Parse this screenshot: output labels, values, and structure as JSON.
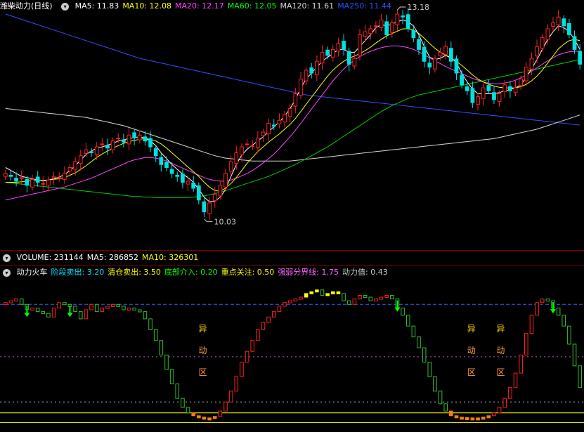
{
  "main_panel": {
    "title": "潍柴动力(日线)",
    "ma_labels": [
      {
        "text": "MA5: 11.83",
        "color": "#ffffff"
      },
      {
        "text": "MA10: 12.08",
        "color": "#ffff00"
      },
      {
        "text": "MA20: 12.17",
        "color": "#ff44ff"
      },
      {
        "text": "MA60: 12.05",
        "color": "#00ff00"
      },
      {
        "text": "MA120: 11.61",
        "color": "#d8d8d8"
      },
      {
        "text": "MA250: 11.44",
        "color": "#3050ff"
      }
    ],
    "high_label": "13.18",
    "low_label": "10.03"
  },
  "volume_panel": {
    "labels": [
      {
        "text": "VOLUME: 231144",
        "color": "#ffffff"
      },
      {
        "text": "MA5: 286852",
        "color": "#ffffff"
      },
      {
        "text": "MA10: 326301",
        "color": "#ffff00"
      }
    ]
  },
  "indicator_panel": {
    "labels": [
      {
        "text": "动力火车",
        "color": "#ffffff"
      },
      {
        "text": "阶段卖出: 3.20",
        "color": "#00e5ff"
      },
      {
        "text": "清仓卖出: 3.50",
        "color": "#ffff00"
      },
      {
        "text": "底部介入: 0.20",
        "color": "#00ff00"
      },
      {
        "text": "重点关注: 0.50",
        "color": "#ffff00"
      },
      {
        "text": "强弱分界线: 1.75",
        "color": "#ff66ff"
      },
      {
        "text": "动力值: 0.43",
        "color": "#cccccc"
      }
    ],
    "zone_label_chars": [
      "异",
      "动",
      "区"
    ]
  },
  "colors": {
    "up": "#ff2020",
    "down": "#00e0e0",
    "ind_up": "#ff2020",
    "ind_down": "#30c030",
    "bottom": "#ff8000",
    "top": "#ffff00",
    "ma5": "#ffffff",
    "ma10": "#ffff00",
    "ma20": "#ff44ff",
    "ma60": "#00cc00",
    "ma120": "#d8d8d8",
    "ma250": "#3050ff"
  },
  "chart_data": {
    "type": "candlestick",
    "price_range": [
      9.6,
      13.55
    ],
    "close": [
      10.85,
      10.8,
      10.72,
      10.78,
      10.65,
      10.75,
      10.7,
      10.68,
      10.74,
      10.8,
      10.78,
      10.85,
      10.95,
      11.05,
      11.15,
      11.25,
      11.2,
      11.3,
      11.35,
      11.28,
      11.4,
      11.45,
      11.38,
      11.5,
      11.45,
      11.5,
      11.4,
      11.3,
      11.15,
      11.0,
      10.95,
      10.85,
      10.8,
      10.7,
      10.72,
      10.6,
      10.4,
      10.2,
      10.35,
      10.5,
      10.65,
      10.85,
      11.05,
      11.2,
      11.3,
      11.35,
      11.32,
      11.45,
      11.55,
      11.7,
      11.65,
      11.75,
      11.85,
      11.95,
      12.2,
      12.45,
      12.6,
      12.55,
      12.75,
      12.9,
      12.85,
      12.95,
      13.05,
      12.95,
      12.7,
      12.8,
      13.2,
      13.25,
      13.3,
      13.35,
      13.45,
      13.2,
      13.4,
      13.55,
      13.5,
      13.3,
      13.15,
      12.95,
      12.75,
      12.65,
      12.8,
      12.9,
      13.0,
      12.75,
      12.55,
      12.35,
      12.25,
      12.05,
      12.15,
      12.3,
      12.25,
      12.1,
      12.2,
      12.35,
      12.25,
      12.3,
      12.45,
      12.65,
      12.8,
      13.0,
      13.15,
      13.3,
      13.4,
      13.5,
      13.35,
      13.2,
      12.95,
      12.7
    ],
    "ma5": [
      10.95,
      10.9,
      10.85,
      10.8,
      10.78,
      10.76,
      10.74,
      10.72,
      10.74,
      10.76,
      10.79,
      10.83,
      10.9,
      10.98,
      11.08,
      11.17,
      11.23,
      11.28,
      11.3,
      11.33,
      11.36,
      11.4,
      11.42,
      11.44,
      11.46,
      11.47,
      11.45,
      11.4,
      11.32,
      11.2,
      11.1,
      11.0,
      10.92,
      10.84,
      10.78,
      10.7,
      10.58,
      10.45,
      10.37,
      10.38,
      10.45,
      10.58,
      10.8,
      11.0,
      11.16,
      11.26,
      11.33,
      11.4,
      11.47,
      11.56,
      11.64,
      11.72,
      11.82,
      11.95,
      12.1,
      12.3,
      12.45,
      12.55,
      12.65,
      12.75,
      12.82,
      12.88,
      12.95,
      12.95,
      12.9,
      12.9,
      13.0,
      13.1,
      13.2,
      13.32,
      13.37,
      13.35,
      13.38,
      13.42,
      13.45,
      13.42,
      13.35,
      13.2,
      13.0,
      12.82,
      12.78,
      12.8,
      12.85,
      12.82,
      12.72,
      12.55,
      12.4,
      12.28,
      12.2,
      12.2,
      12.2,
      12.2,
      12.22,
      12.25,
      12.27,
      12.3,
      12.35,
      12.48,
      12.62,
      12.78,
      12.95,
      13.12,
      13.25,
      13.35,
      13.32,
      13.25,
      13.12,
      12.95
    ],
    "ma10": [
      10.7,
      10.7,
      10.7,
      10.71,
      10.72,
      10.73,
      10.73,
      10.73,
      10.74,
      10.75,
      10.76,
      10.78,
      10.82,
      10.86,
      10.92,
      10.98,
      11.05,
      11.12,
      11.18,
      11.23,
      11.28,
      11.32,
      11.36,
      11.39,
      11.41,
      11.43,
      11.44,
      11.43,
      11.4,
      11.35,
      11.28,
      11.2,
      11.12,
      11.04,
      10.96,
      10.88,
      10.8,
      10.7,
      10.62,
      10.56,
      10.55,
      10.6,
      10.68,
      10.78,
      10.9,
      11.02,
      11.12,
      11.22,
      11.3,
      11.38,
      11.45,
      11.52,
      11.6,
      11.68,
      11.78,
      11.9,
      12.02,
      12.14,
      12.26,
      12.38,
      12.5,
      12.6,
      12.68,
      12.75,
      12.8,
      12.84,
      12.88,
      12.93,
      12.99,
      13.06,
      13.12,
      13.18,
      13.22,
      13.26,
      13.3,
      13.3,
      13.28,
      13.22,
      13.14,
      13.05,
      12.97,
      12.9,
      12.85,
      12.8,
      12.75,
      12.68,
      12.6,
      12.52,
      12.45,
      12.4,
      12.36,
      12.33,
      12.31,
      12.3,
      12.3,
      12.3,
      12.32,
      12.36,
      12.42,
      12.5,
      12.6,
      12.72,
      12.84,
      12.96,
      13.04,
      13.1,
      13.12,
      13.1
    ],
    "ma20": [
      10.4,
      10.42,
      10.44,
      10.46,
      10.48,
      10.5,
      10.52,
      10.54,
      10.56,
      10.58,
      10.6,
      10.62,
      10.65,
      10.68,
      10.71,
      10.74,
      10.77,
      10.81,
      10.85,
      10.89,
      10.93,
      10.97,
      11.01,
      11.05,
      11.08,
      11.1,
      11.12,
      11.12,
      11.11,
      11.09,
      11.06,
      11.02,
      10.98,
      10.94,
      10.9,
      10.86,
      10.82,
      10.78,
      10.75,
      10.73,
      10.72,
      10.72,
      10.74,
      10.77,
      10.81,
      10.85,
      10.9,
      10.96,
      11.03,
      11.1,
      11.18,
      11.27,
      11.37,
      11.47,
      11.58,
      11.7,
      11.82,
      11.94,
      12.06,
      12.18,
      12.3,
      12.42,
      12.52,
      12.62,
      12.7,
      12.77,
      12.83,
      12.88,
      12.92,
      12.95,
      12.98,
      13.0,
      13.01,
      13.01,
      13.0,
      12.98,
      12.95,
      12.91,
      12.86,
      12.81,
      12.76,
      12.71,
      12.66,
      12.62,
      12.58,
      12.54,
      12.5,
      12.46,
      12.43,
      12.4,
      12.38,
      12.37,
      12.37,
      12.38,
      12.4,
      12.43,
      12.47,
      12.52,
      12.58,
      12.64,
      12.7,
      12.76,
      12.81,
      12.86,
      12.89,
      12.91,
      12.92,
      12.92
    ],
    "ma60": [
      10.7,
      10.69,
      10.68,
      10.67,
      10.66,
      10.65,
      10.64,
      10.63,
      10.62,
      10.61,
      10.6,
      10.59,
      10.58,
      10.57,
      10.56,
      10.55,
      10.54,
      10.53,
      10.52,
      10.51,
      10.5,
      10.49,
      10.48,
      10.47,
      10.46,
      10.46,
      10.45,
      10.45,
      10.44,
      10.44,
      10.44,
      10.44,
      10.44,
      10.44,
      10.44,
      10.45,
      10.46,
      10.47,
      10.49,
      10.51,
      10.53,
      10.56,
      10.59,
      10.62,
      10.65,
      10.68,
      10.71,
      10.74,
      10.77,
      10.8,
      10.84,
      10.88,
      10.92,
      10.96,
      11.0,
      11.05,
      11.1,
      11.15,
      11.2,
      11.25,
      11.3,
      11.36,
      11.42,
      11.48,
      11.54,
      11.6,
      11.66,
      11.72,
      11.78,
      11.84,
      11.9,
      11.95,
      12.0,
      12.04,
      12.08,
      12.12,
      12.15,
      12.18,
      12.2,
      12.22,
      12.24,
      12.26,
      12.28,
      12.3,
      12.32,
      12.34,
      12.36,
      12.38,
      12.4,
      12.42,
      12.44,
      12.46,
      12.48,
      12.5,
      12.52,
      12.54,
      12.56,
      12.58,
      12.6,
      12.62,
      12.64,
      12.66,
      12.68,
      12.7,
      12.72,
      12.74,
      12.76,
      12.78
    ],
    "ma120": [
      11.95,
      11.94,
      11.93,
      11.92,
      11.91,
      11.9,
      11.89,
      11.88,
      11.87,
      11.86,
      11.85,
      11.84,
      11.83,
      11.82,
      11.81,
      11.8,
      11.78,
      11.76,
      11.74,
      11.72,
      11.7,
      11.68,
      11.66,
      11.63,
      11.6,
      11.57,
      11.54,
      11.51,
      11.48,
      11.45,
      11.42,
      11.39,
      11.36,
      11.33,
      11.3,
      11.27,
      11.24,
      11.21,
      11.18,
      11.15,
      11.13,
      11.11,
      11.1,
      11.09,
      11.08,
      11.07,
      11.06,
      11.06,
      11.06,
      11.06,
      11.06,
      11.06,
      11.06,
      11.06,
      11.07,
      11.08,
      11.09,
      11.1,
      11.11,
      11.12,
      11.13,
      11.14,
      11.15,
      11.16,
      11.17,
      11.18,
      11.19,
      11.2,
      11.21,
      11.22,
      11.23,
      11.24,
      11.25,
      11.26,
      11.27,
      11.28,
      11.29,
      11.3,
      11.31,
      11.32,
      11.33,
      11.34,
      11.35,
      11.36,
      11.37,
      11.38,
      11.39,
      11.4,
      11.41,
      11.42,
      11.43,
      11.44,
      11.46,
      11.48,
      11.5,
      11.52,
      11.54,
      11.56,
      11.58,
      11.6,
      11.63,
      11.66,
      11.69,
      11.72,
      11.75,
      11.78,
      11.81,
      11.84
    ],
    "ma250": [
      13.55,
      13.52,
      13.49,
      13.46,
      13.43,
      13.4,
      13.37,
      13.34,
      13.31,
      13.28,
      13.25,
      13.22,
      13.19,
      13.16,
      13.13,
      13.1,
      13.07,
      13.04,
      13.01,
      12.98,
      12.95,
      12.92,
      12.89,
      12.86,
      12.83,
      12.8,
      12.78,
      12.76,
      12.74,
      12.72,
      12.7,
      12.68,
      12.66,
      12.64,
      12.62,
      12.6,
      12.58,
      12.56,
      12.54,
      12.52,
      12.5,
      12.48,
      12.46,
      12.44,
      12.42,
      12.4,
      12.38,
      12.36,
      12.34,
      12.32,
      12.3,
      12.28,
      12.26,
      12.24,
      12.22,
      12.2,
      12.18,
      12.17,
      12.16,
      12.15,
      12.14,
      12.13,
      12.12,
      12.11,
      12.1,
      12.09,
      12.08,
      12.07,
      12.06,
      12.05,
      12.04,
      12.03,
      12.02,
      12.01,
      12.0,
      11.99,
      11.98,
      11.97,
      11.96,
      11.95,
      11.94,
      11.93,
      11.92,
      11.91,
      11.9,
      11.89,
      11.88,
      11.87,
      11.86,
      11.85,
      11.84,
      11.83,
      11.82,
      11.81,
      11.8,
      11.79,
      11.78,
      11.77,
      11.76,
      11.75,
      11.74,
      11.73,
      11.72,
      11.71,
      11.7,
      11.69,
      11.68,
      11.67
    ],
    "indicator": [
      3.25,
      3.3,
      3.35,
      3.2,
      3.05,
      3.1,
      3.0,
      2.95,
      2.85,
      3.1,
      3.25,
      3.2,
      3.15,
      3.0,
      2.8,
      3.05,
      3.2,
      3.0,
      3.1,
      3.15,
      3.2,
      3.15,
      3.05,
      3.1,
      3.05,
      3.0,
      2.8,
      2.5,
      2.2,
      1.8,
      1.4,
      1.0,
      0.6,
      0.35,
      0.2,
      0.12,
      0.08,
      0.06,
      0.05,
      0.1,
      0.25,
      0.5,
      0.8,
      1.2,
      1.6,
      1.9,
      2.2,
      2.5,
      2.7,
      2.85,
      3.0,
      3.15,
      3.25,
      3.3,
      3.35,
      3.4,
      3.5,
      3.55,
      3.6,
      3.45,
      3.5,
      3.55,
      3.5,
      3.3,
      3.2,
      3.35,
      3.45,
      3.4,
      3.3,
      3.35,
      3.4,
      3.45,
      3.35,
      3.1,
      2.9,
      2.6,
      2.3,
      2.0,
      1.6,
      1.2,
      0.8,
      0.45,
      0.25,
      0.12,
      0.08,
      0.07,
      0.06,
      0.05,
      0.06,
      0.08,
      0.12,
      0.2,
      0.35,
      0.6,
      0.9,
      1.3,
      1.8,
      2.4,
      2.9,
      3.25,
      3.35,
      3.3,
      3.1,
      2.9,
      2.6,
      2.1,
      1.5,
      0.9
    ]
  }
}
